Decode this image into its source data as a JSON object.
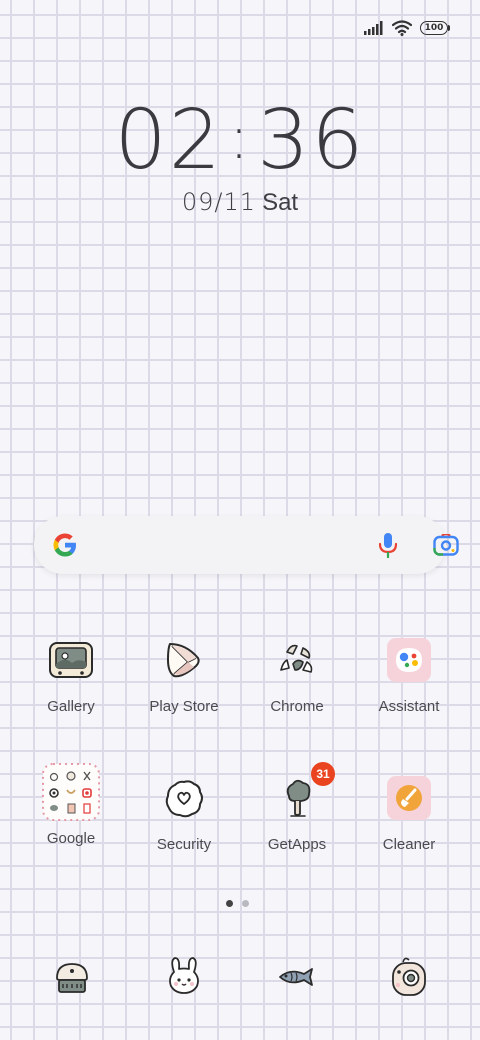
{
  "status_bar": {
    "battery_level": "100",
    "icons": [
      "signal-icon",
      "wifi-icon",
      "battery-icon"
    ]
  },
  "clock": {
    "hours": "02",
    "separator": ":",
    "minutes": "36"
  },
  "date": {
    "day_month": "09/11",
    "weekday": "Sat"
  },
  "search": {
    "icons": [
      "google-icon",
      "mic-icon",
      "lens-icon"
    ]
  },
  "apps_row1": [
    {
      "label": "Gallery",
      "icon": "gallery-icon"
    },
    {
      "label": "Play Store",
      "icon": "play-store-icon"
    },
    {
      "label": "Chrome",
      "icon": "chrome-icon"
    },
    {
      "label": "Assistant",
      "icon": "assistant-icon"
    }
  ],
  "apps_row2": [
    {
      "label": "Google",
      "icon": "google-folder-icon"
    },
    {
      "label": "Security",
      "icon": "security-icon"
    },
    {
      "label": "GetApps",
      "icon": "getapps-icon",
      "badge": "31"
    },
    {
      "label": "Cleaner",
      "icon": "cleaner-icon"
    }
  ],
  "page_indicator": {
    "pages": 2,
    "current": 1
  },
  "dock": [
    {
      "icon": "phone-icon"
    },
    {
      "icon": "messages-icon"
    },
    {
      "icon": "browser-icon"
    },
    {
      "icon": "camera-icon"
    }
  ],
  "colors": {
    "background": "#f6f5f9",
    "grid": "#dcdae6",
    "badge": "#e9441f",
    "assistant_tile": "#f6d3da",
    "cleaner_tile": "#f6d3da",
    "cleaner_circle": "#f0a43a"
  }
}
